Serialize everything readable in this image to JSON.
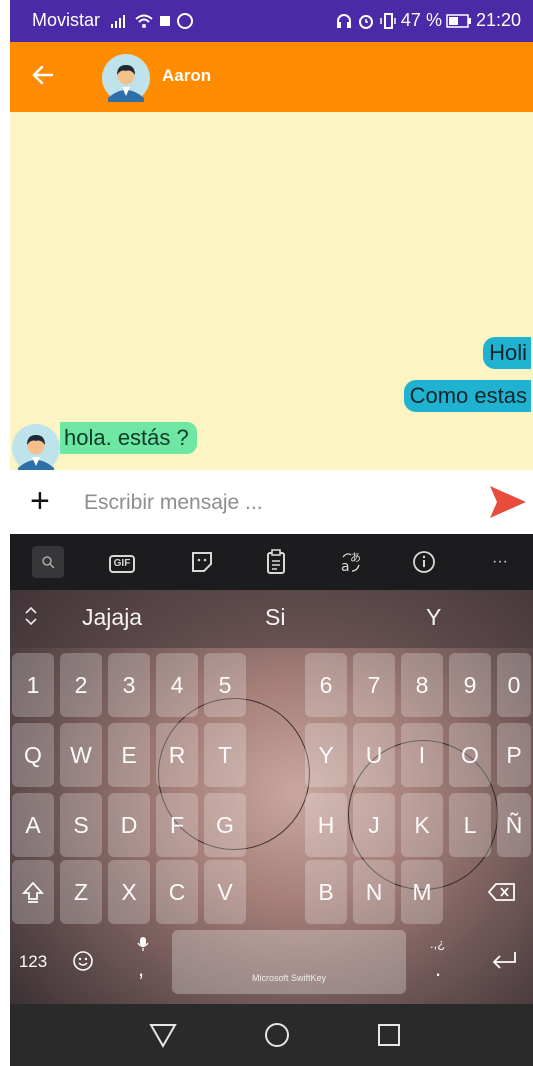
{
  "status_bar": {
    "carrier": "Movistar",
    "battery": "47 %",
    "time": "21:20"
  },
  "header": {
    "contact_name": "Aaron"
  },
  "messages": [
    {
      "direction": "outgoing",
      "text": "Holi"
    },
    {
      "direction": "outgoing",
      "text": "Como estas"
    },
    {
      "direction": "incoming",
      "text": "hola. estás ?"
    }
  ],
  "composer": {
    "plus_label": "+",
    "placeholder": "Escribir mensaje ..."
  },
  "keyboard": {
    "toolbar": {
      "gif_label": "GIF",
      "more_label": "···"
    },
    "suggestions": [
      "Jajaja",
      "Si",
      "Y"
    ],
    "rows": [
      [
        "1",
        "2",
        "3",
        "4",
        "5",
        "6",
        "7",
        "8",
        "9",
        "0"
      ],
      [
        "Q",
        "W",
        "E",
        "R",
        "T",
        "Y",
        "U",
        "I",
        "O",
        "P"
      ],
      [
        "A",
        "S",
        "D",
        "F",
        "G",
        "H",
        "J",
        "K",
        "L",
        "Ñ"
      ],
      [
        "Z",
        "X",
        "C",
        "V",
        "B",
        "N",
        "M"
      ]
    ],
    "numbers_label": "123",
    "comma_label": ",",
    "period_label": ".",
    "period_hint": ".,¿",
    "space_label": "Microsoft SwiftKey"
  },
  "colors": {
    "status_bar": "#4a2aa6",
    "app_bar": "#ff8c00",
    "chat_background": "#fcf4c2",
    "outgoing_bubble": "#1fb3d1",
    "incoming_bubble": "#6ee7a3",
    "send_icon": "#e74c3c"
  },
  "icons": {
    "back": "arrow-left-icon",
    "send": "send-icon",
    "shift": "shift-icon",
    "backspace": "backspace-icon",
    "enter": "enter-icon",
    "emoji": "emoji-icon",
    "mic": "mic-icon"
  }
}
